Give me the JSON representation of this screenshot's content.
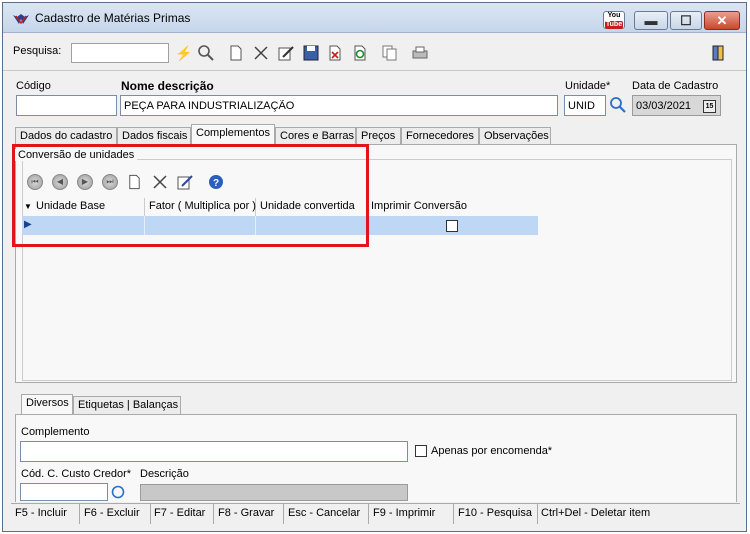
{
  "window": {
    "title": "Cadastro de Matérias Primas",
    "youtube_top": "You",
    "youtube_bottom": "Tube"
  },
  "toolbar": {
    "search_label": "Pesquisa:",
    "search_value": "",
    "icons": [
      "wand-icon",
      "search-icon",
      "new-icon",
      "delete-icon",
      "edit-icon",
      "save-icon",
      "cancel-icon",
      "refresh-icon",
      "copy-icon",
      "print-icon",
      "exit-icon"
    ]
  },
  "header": {
    "codigo_label": "Código",
    "codigo_value": "",
    "nome_label": "Nome descrição",
    "nome_value": "PEÇA PARA INDUSTRIALIZAÇÃO",
    "unidade_label": "Unidade*",
    "unidade_value": "UNID",
    "data_label": "Data de Cadastro",
    "data_value": "03/03/2021",
    "calendar_day": "15"
  },
  "tabs": [
    "Dados do cadastro",
    "Dados fiscais",
    "Complementos",
    "Cores e Barras",
    "Preços",
    "Fornecedores",
    "Observações"
  ],
  "active_tab": "Complementos",
  "conversion": {
    "title": "Conversão de unidades",
    "columns": [
      "Unidade Base",
      "Fator ( Multiplica por )",
      "Unidade convertida",
      "Imprimir Conversão"
    ],
    "row": {
      "unidade_base": "",
      "fator": "",
      "unidade_convertida": "",
      "imprimir": false
    }
  },
  "lower_tabs": [
    "Diversos",
    "Etiquetas | Balanças"
  ],
  "active_lower_tab": "Diversos",
  "diversos": {
    "complemento_label": "Complemento",
    "complemento_value": "",
    "encomenda_label": "Apenas por encomenda*",
    "encomenda_checked": false,
    "custo_label": "Cód. C. Custo Credor*",
    "descricao_label": "Descrição"
  },
  "status_bar": [
    "F5 - Incluir",
    "F6 - Excluir",
    "F7 - Editar",
    "F8 - Gravar",
    "Esc - Cancelar",
    "F9 - Imprimir",
    "F10 - Pesquisa",
    "Ctrl+Del - Deletar item"
  ],
  "colors": {
    "highlight": "#e1141e",
    "selected_row": "#bdd7f4",
    "titlebar": "#c6d6ea"
  }
}
